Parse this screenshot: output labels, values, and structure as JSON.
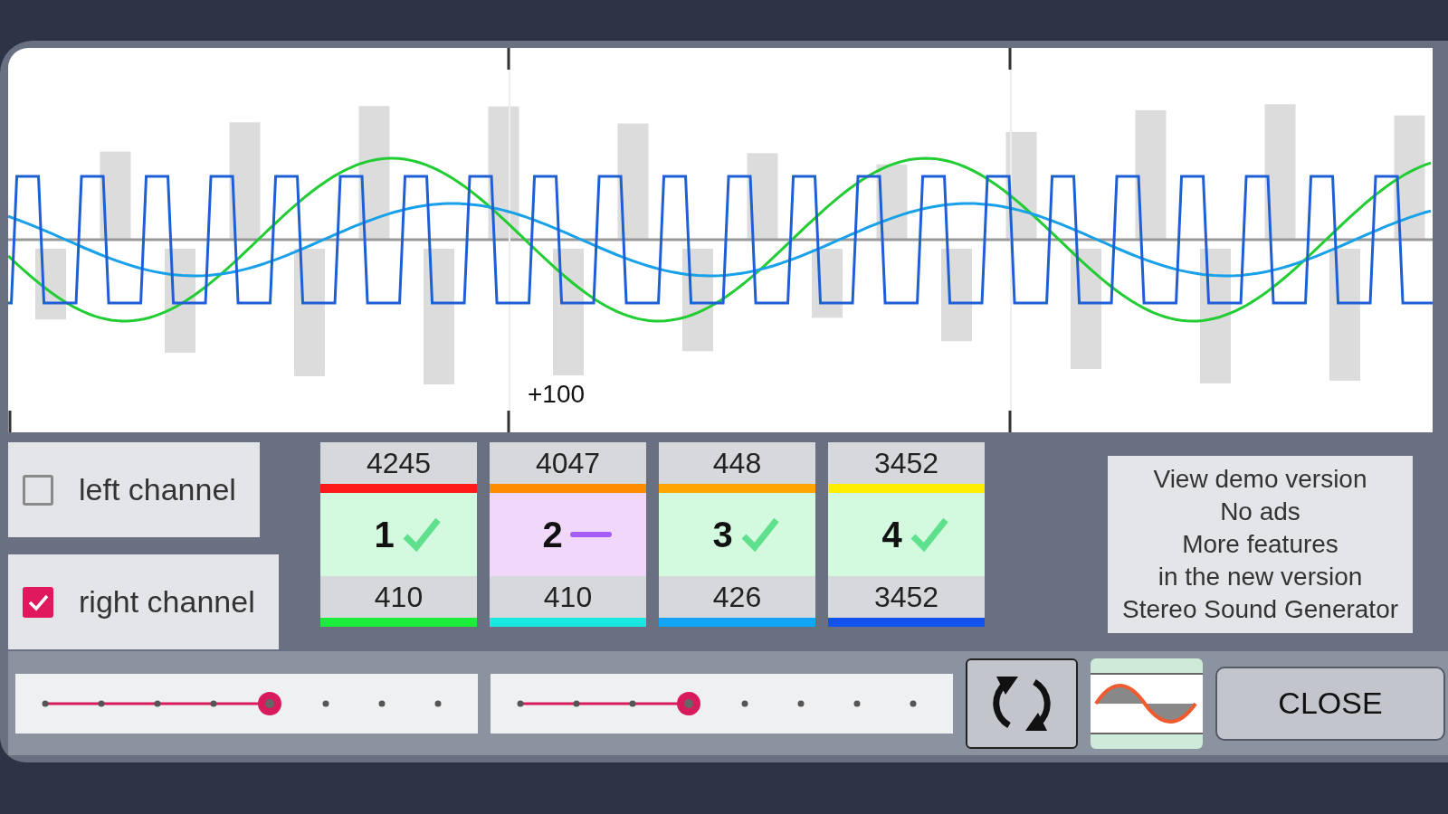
{
  "scope": {
    "marker_label": "+100"
  },
  "channels": [
    {
      "label": "left channel",
      "checked": false
    },
    {
      "label": "right channel",
      "checked": true
    }
  ],
  "generators": [
    {
      "top": {
        "value": "4245",
        "color": "#ff1a1a"
      },
      "number": "1",
      "enabled": true,
      "bottom": {
        "value": "410",
        "color": "#1aee3a"
      }
    },
    {
      "top": {
        "value": "4047",
        "color": "#ff8c00"
      },
      "number": "2",
      "enabled": false,
      "bottom": {
        "value": "410",
        "color": "#19e8e0"
      }
    },
    {
      "top": {
        "value": "448",
        "color": "#ffa500"
      },
      "number": "3",
      "enabled": true,
      "bottom": {
        "value": "426",
        "color": "#12a4f5"
      }
    },
    {
      "top": {
        "value": "3452",
        "color": "#ffee00"
      },
      "number": "4",
      "enabled": true,
      "bottom": {
        "value": "3452",
        "color": "#1452f0"
      }
    }
  ],
  "promo": {
    "lines": [
      "View demo version",
      "No ads",
      "More features",
      "in the new version",
      "Stereo Sound Generator"
    ]
  },
  "sliders": [
    {
      "level": 0.571
    },
    {
      "level": 0.429
    }
  ],
  "close_button": {
    "label": "CLOSE"
  }
}
